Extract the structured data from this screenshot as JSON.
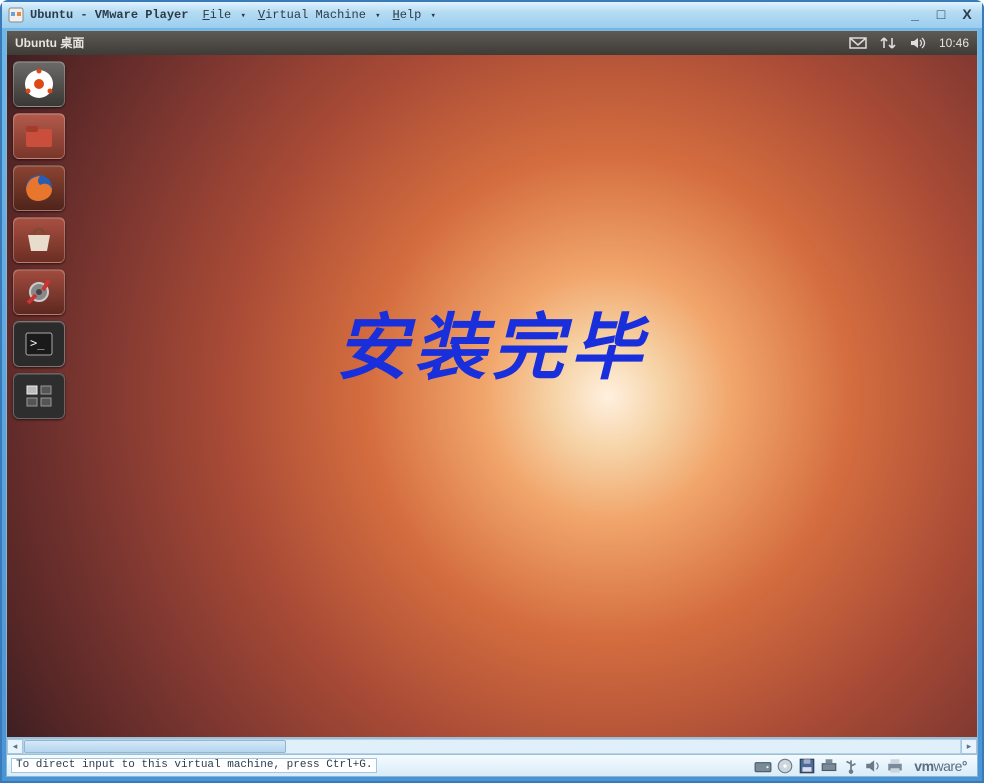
{
  "window": {
    "title": "Ubuntu - VMware Player",
    "menus": [
      {
        "label": "File",
        "mnemonic_html": "<span class='underline'>F</span>ile"
      },
      {
        "label": "Virtual Machine",
        "mnemonic_html": "<span class='underline'>V</span>irtual Machine"
      },
      {
        "label": "Help",
        "mnemonic_html": "<span class='underline'>H</span>elp"
      }
    ],
    "controls": {
      "minimize": "_",
      "maximize": "□",
      "close": "X"
    }
  },
  "ubuntu": {
    "panel_title": "Ubuntu 桌面",
    "clock": "10:46",
    "indicators": {
      "mail": "mail-icon",
      "network": "network-updown-icon",
      "sound": "volume-icon"
    },
    "launcher": [
      {
        "id": "dash",
        "name": "dash-home-icon"
      },
      {
        "id": "files",
        "name": "files-icon"
      },
      {
        "id": "firefox",
        "name": "firefox-icon"
      },
      {
        "id": "software",
        "name": "software-center-icon"
      },
      {
        "id": "settings",
        "name": "system-settings-icon"
      },
      {
        "id": "terminal",
        "name": "terminal-icon"
      },
      {
        "id": "workspace",
        "name": "workspace-switcher-icon"
      }
    ],
    "overlay_message": "安装完毕"
  },
  "vmware_status": {
    "hint": "To direct input to this virtual machine, press Ctrl+G.",
    "devices": [
      "hard-disk-icon",
      "cd-dvd-icon",
      "floppy-icon",
      "network-adapter-icon",
      "usb-icon",
      "sound-card-icon",
      "printer-icon"
    ],
    "brand": "vmware"
  }
}
